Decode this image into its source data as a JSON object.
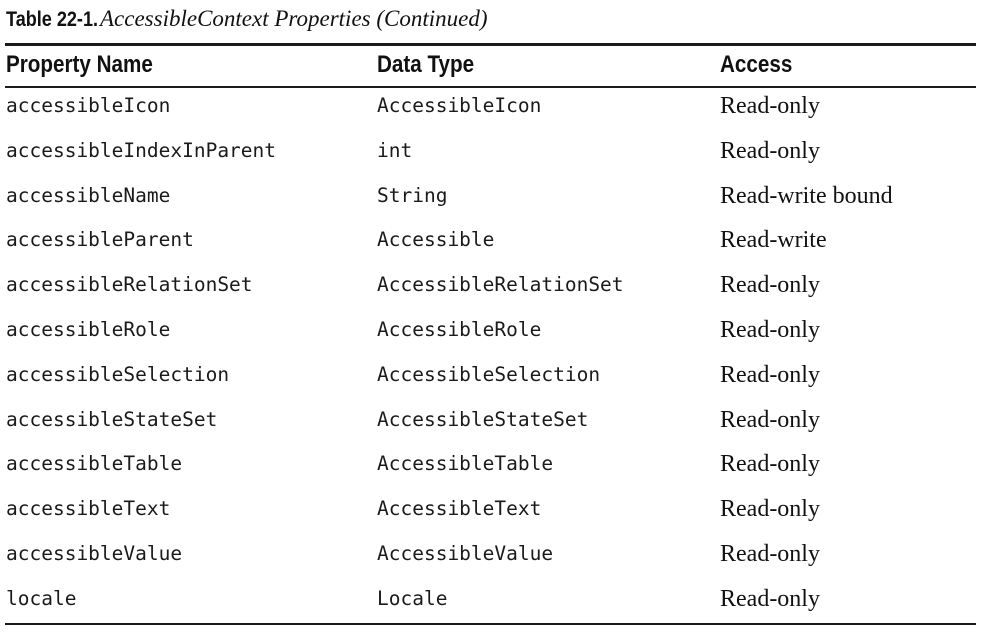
{
  "caption": {
    "label": "Table 22-1.",
    "title": "AccessibleContext Properties (Continued)"
  },
  "table": {
    "headers": [
      "Property Name",
      "Data Type",
      "Access"
    ],
    "rows": [
      [
        "accessibleIcon",
        "AccessibleIcon",
        "Read-only"
      ],
      [
        "accessibleIndexInParent",
        "int",
        "Read-only"
      ],
      [
        "accessibleName",
        "String",
        "Read-write bound"
      ],
      [
        "accessibleParent",
        "Accessible",
        "Read-write"
      ],
      [
        "accessibleRelationSet",
        "AccessibleRelationSet",
        "Read-only"
      ],
      [
        "accessibleRole",
        "AccessibleRole",
        "Read-only"
      ],
      [
        "accessibleSelection",
        "AccessibleSelection",
        "Read-only"
      ],
      [
        "accessibleStateSet",
        "AccessibleStateSet",
        "Read-only"
      ],
      [
        "accessibleTable",
        "AccessibleTable",
        "Read-only"
      ],
      [
        "accessibleText",
        "AccessibleText",
        "Read-only"
      ],
      [
        "accessibleValue",
        "AccessibleValue",
        "Read-only"
      ],
      [
        "locale",
        "Locale",
        "Read-only"
      ]
    ]
  }
}
